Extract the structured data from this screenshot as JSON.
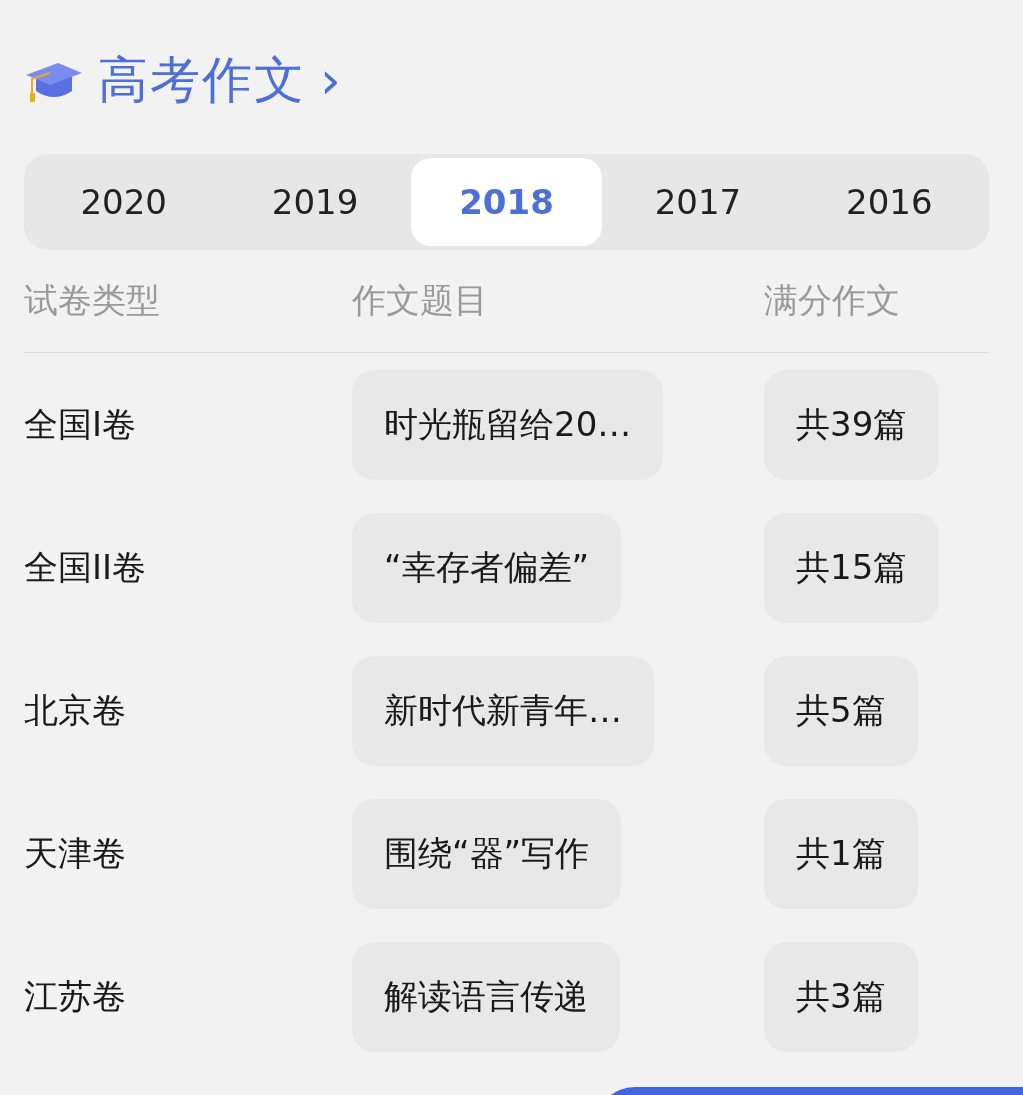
{
  "header": {
    "title": "高考作文",
    "chevron": "›"
  },
  "years": [
    {
      "label": "2020",
      "selected": false
    },
    {
      "label": "2019",
      "selected": false
    },
    {
      "label": "2018",
      "selected": true
    },
    {
      "label": "2017",
      "selected": false
    },
    {
      "label": "2016",
      "selected": false
    }
  ],
  "table": {
    "columns": [
      "试卷类型",
      "作文题目",
      "满分作文"
    ],
    "rows": [
      {
        "paper": "全国I卷",
        "topic": "时光瓶留给20…",
        "count": "共39篇"
      },
      {
        "paper": "全国II卷",
        "topic": "“幸存者偏差”",
        "count": "共15篇"
      },
      {
        "paper": "北京卷",
        "topic": "新时代新青年…",
        "count": "共5篇"
      },
      {
        "paper": "天津卷",
        "topic": "围绕“器”写作",
        "count": "共1篇"
      },
      {
        "paper": "江苏卷",
        "topic": "解读语言传递",
        "count": "共3篇"
      }
    ]
  }
}
